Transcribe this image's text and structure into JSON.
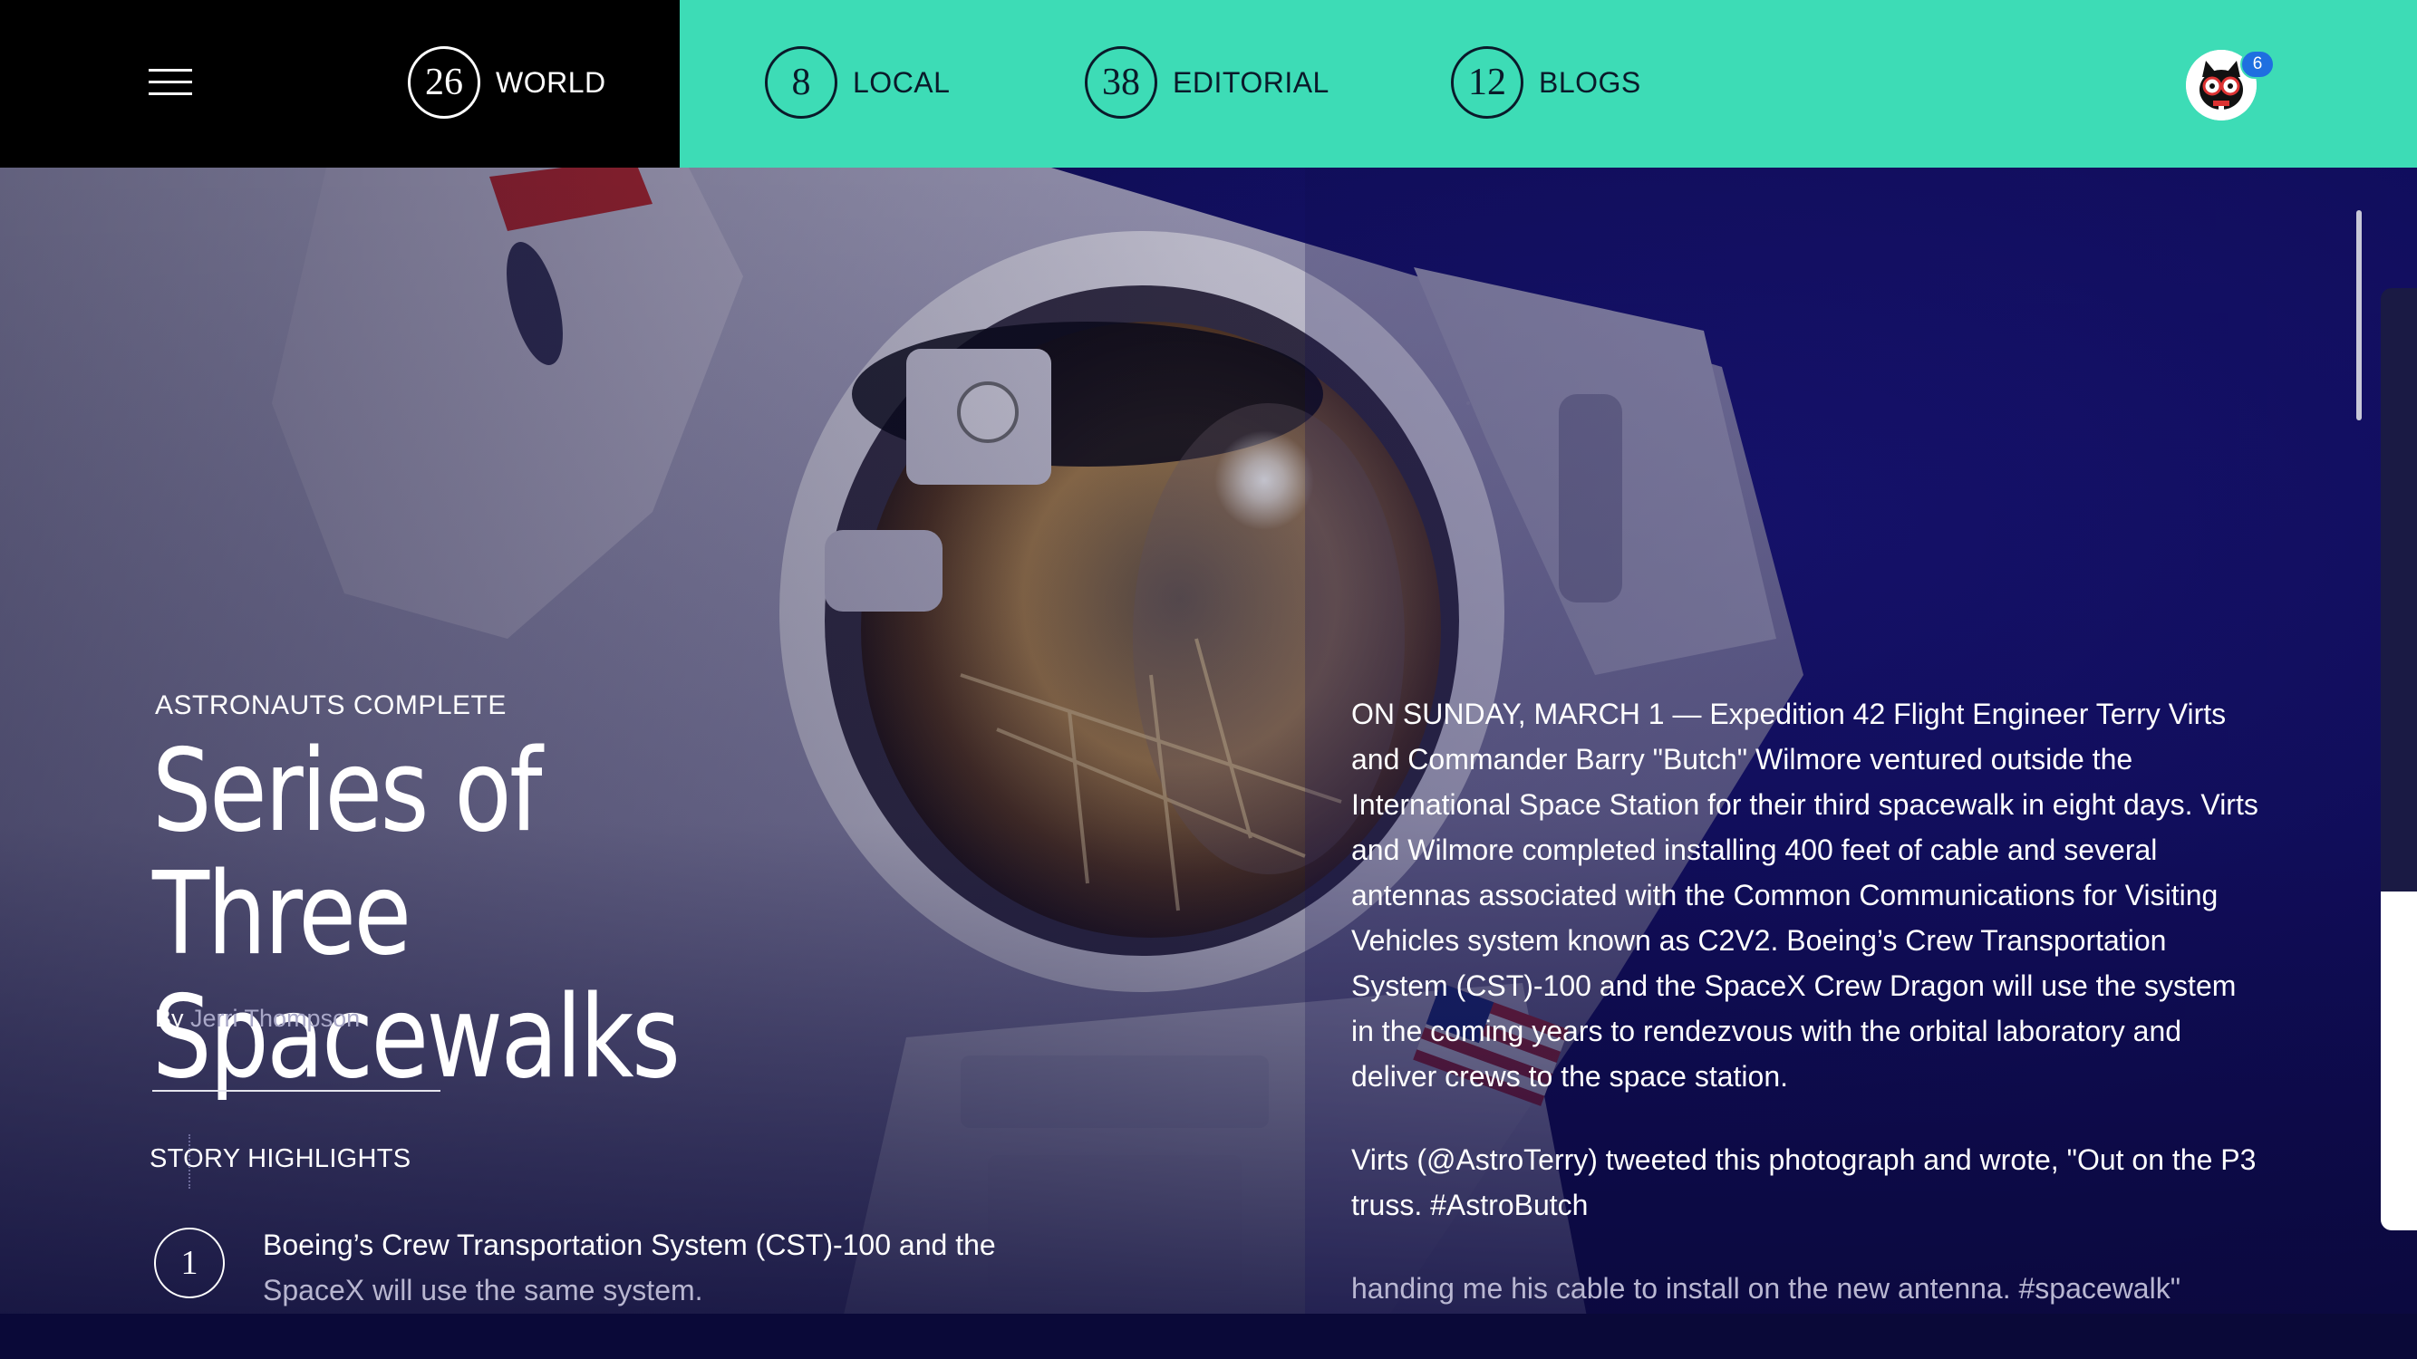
{
  "header": {
    "nav": [
      {
        "count": "26",
        "label": "WORLD"
      },
      {
        "count": "8",
        "label": "LOCAL"
      },
      {
        "count": "38",
        "label": "EDITORIAL"
      },
      {
        "count": "12",
        "label": "BLOGS"
      }
    ],
    "notification_count": "6",
    "colors": {
      "left_bg": "#000000",
      "right_bg": "#3ddcb6",
      "badge": "#1f6fe0"
    }
  },
  "article": {
    "kicker": "ASTRONAUTS COMPLETE",
    "title_line1": "Series of Three",
    "title_line2": "Spacewalks",
    "byline_prefix": "By",
    "author": "Jerri Thompson",
    "highlights_title": "STORY HIGHLIGHTS",
    "highlights": [
      {
        "number": "1",
        "text_main": "Boeing’s Crew Transportation System (CST)-100 and the",
        "text_dim": "SpaceX will use the same system."
      }
    ],
    "body": [
      "ON SUNDAY, MARCH 1 — Expedition 42 Flight Engineer Terry Virts and Commander Barry \"Butch\" Wilmore ventured outside the International Space Station for their third spacewalk in eight days. Virts and Wilmore completed installing 400 feet of cable and several antennas associated with the Common Communications for Visiting Vehicles system known as C2V2. Boeing’s Crew Transportation System (CST)-100 and the SpaceX Crew Dragon will use the system in the coming years to rendezvous with the orbital laboratory and deliver crews to the space station.",
      "Virts (@AstroTerry) tweeted this photograph and wrote, \"Out on the P3 truss. #AstroButch",
      "handing me his cable to install on the new antenna. #spacewalk\""
    ]
  }
}
